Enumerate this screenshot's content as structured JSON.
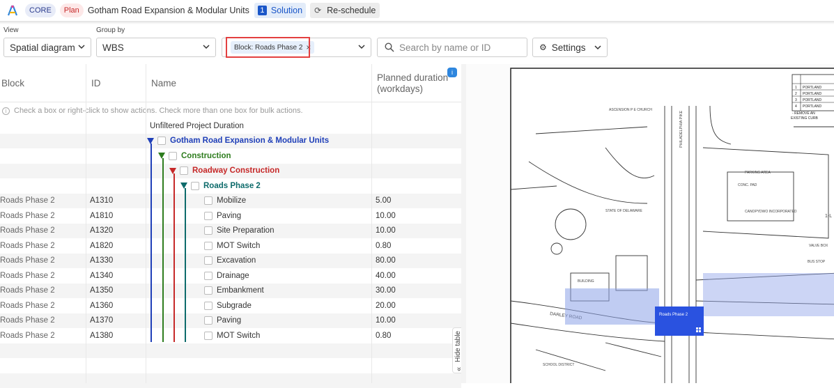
{
  "topbar": {
    "core_label": "CORE",
    "plan_label": "Plan",
    "project_title": "Gotham Road Expansion & Modular Units",
    "solution_number": "1",
    "solution_label": "Solution",
    "reschedule_label": "Re-schedule"
  },
  "filters": {
    "view_label": "View",
    "view_value": "Spatial diagram",
    "groupby_label": "Group by",
    "groupby_value": "WBS",
    "filter_chip": "Block: Roads Phase 2",
    "search_placeholder": "Search by name or ID",
    "settings_label": "Settings"
  },
  "table": {
    "headers": {
      "block": "Block",
      "id": "ID",
      "name": "Name",
      "duration_line1": "Planned duration",
      "duration_line2": "(workdays)"
    },
    "info_text": "Check a box or right-click to show actions. Check more than one box for bulk actions.",
    "unfiltered_label": "Unfiltered Project Duration",
    "groups": [
      {
        "label": "Gotham Road Expansion & Modular Units",
        "color": "#1f3fb8"
      },
      {
        "label": "Construction",
        "color": "#2e7d1e"
      },
      {
        "label": "Roadway Construction",
        "color": "#c62828"
      },
      {
        "label": "Roads Phase 2",
        "color": "#0d6b6b"
      }
    ],
    "rows": [
      {
        "block": "Roads Phase 2",
        "id": "A1310",
        "name": "Mobilize",
        "duration": "5.00"
      },
      {
        "block": "Roads Phase 2",
        "id": "A1810",
        "name": "Paving",
        "duration": "10.00"
      },
      {
        "block": "Roads Phase 2",
        "id": "A1320",
        "name": "Site Preparation",
        "duration": "10.00"
      },
      {
        "block": "Roads Phase 2",
        "id": "A1820",
        "name": "MOT Switch",
        "duration": "0.80"
      },
      {
        "block": "Roads Phase 2",
        "id": "A1330",
        "name": "Excavation",
        "duration": "80.00"
      },
      {
        "block": "Roads Phase 2",
        "id": "A1340",
        "name": "Drainage",
        "duration": "40.00"
      },
      {
        "block": "Roads Phase 2",
        "id": "A1350",
        "name": "Embankment",
        "duration": "30.00"
      },
      {
        "block": "Roads Phase 2",
        "id": "A1360",
        "name": "Subgrade",
        "duration": "20.00"
      },
      {
        "block": "Roads Phase 2",
        "id": "A1370",
        "name": "Paving",
        "duration": "10.00"
      },
      {
        "block": "Roads Phase 2",
        "id": "A1380",
        "name": "MOT Switch",
        "duration": "0.80"
      }
    ],
    "hide_table_label": "Hide table"
  },
  "map": {
    "block_label": "Roads Phase 2",
    "street_labels": [
      "DARLEY ROAD",
      "PHILADELPHIA PIKE",
      "ASCENSION P E CHURCH",
      "STATE OF DELAWARE",
      "VALVE BOX",
      "BUS STOP",
      "CANOPY",
      "CONC. PAD",
      "DWO INCORPORATED",
      "BUILDING",
      "PARKING AREA",
      "SCHOOL DISTRICT",
      "1-L"
    ],
    "legend_rows": [
      "PORTLAND",
      "PORTLAND",
      "PORTLAND",
      "PORTLAND"
    ],
    "legend_numbers": [
      "1",
      "2",
      "3",
      "4"
    ],
    "legend_note1": "- REMOVE AN",
    "legend_note2": "EXISTING CURB"
  }
}
